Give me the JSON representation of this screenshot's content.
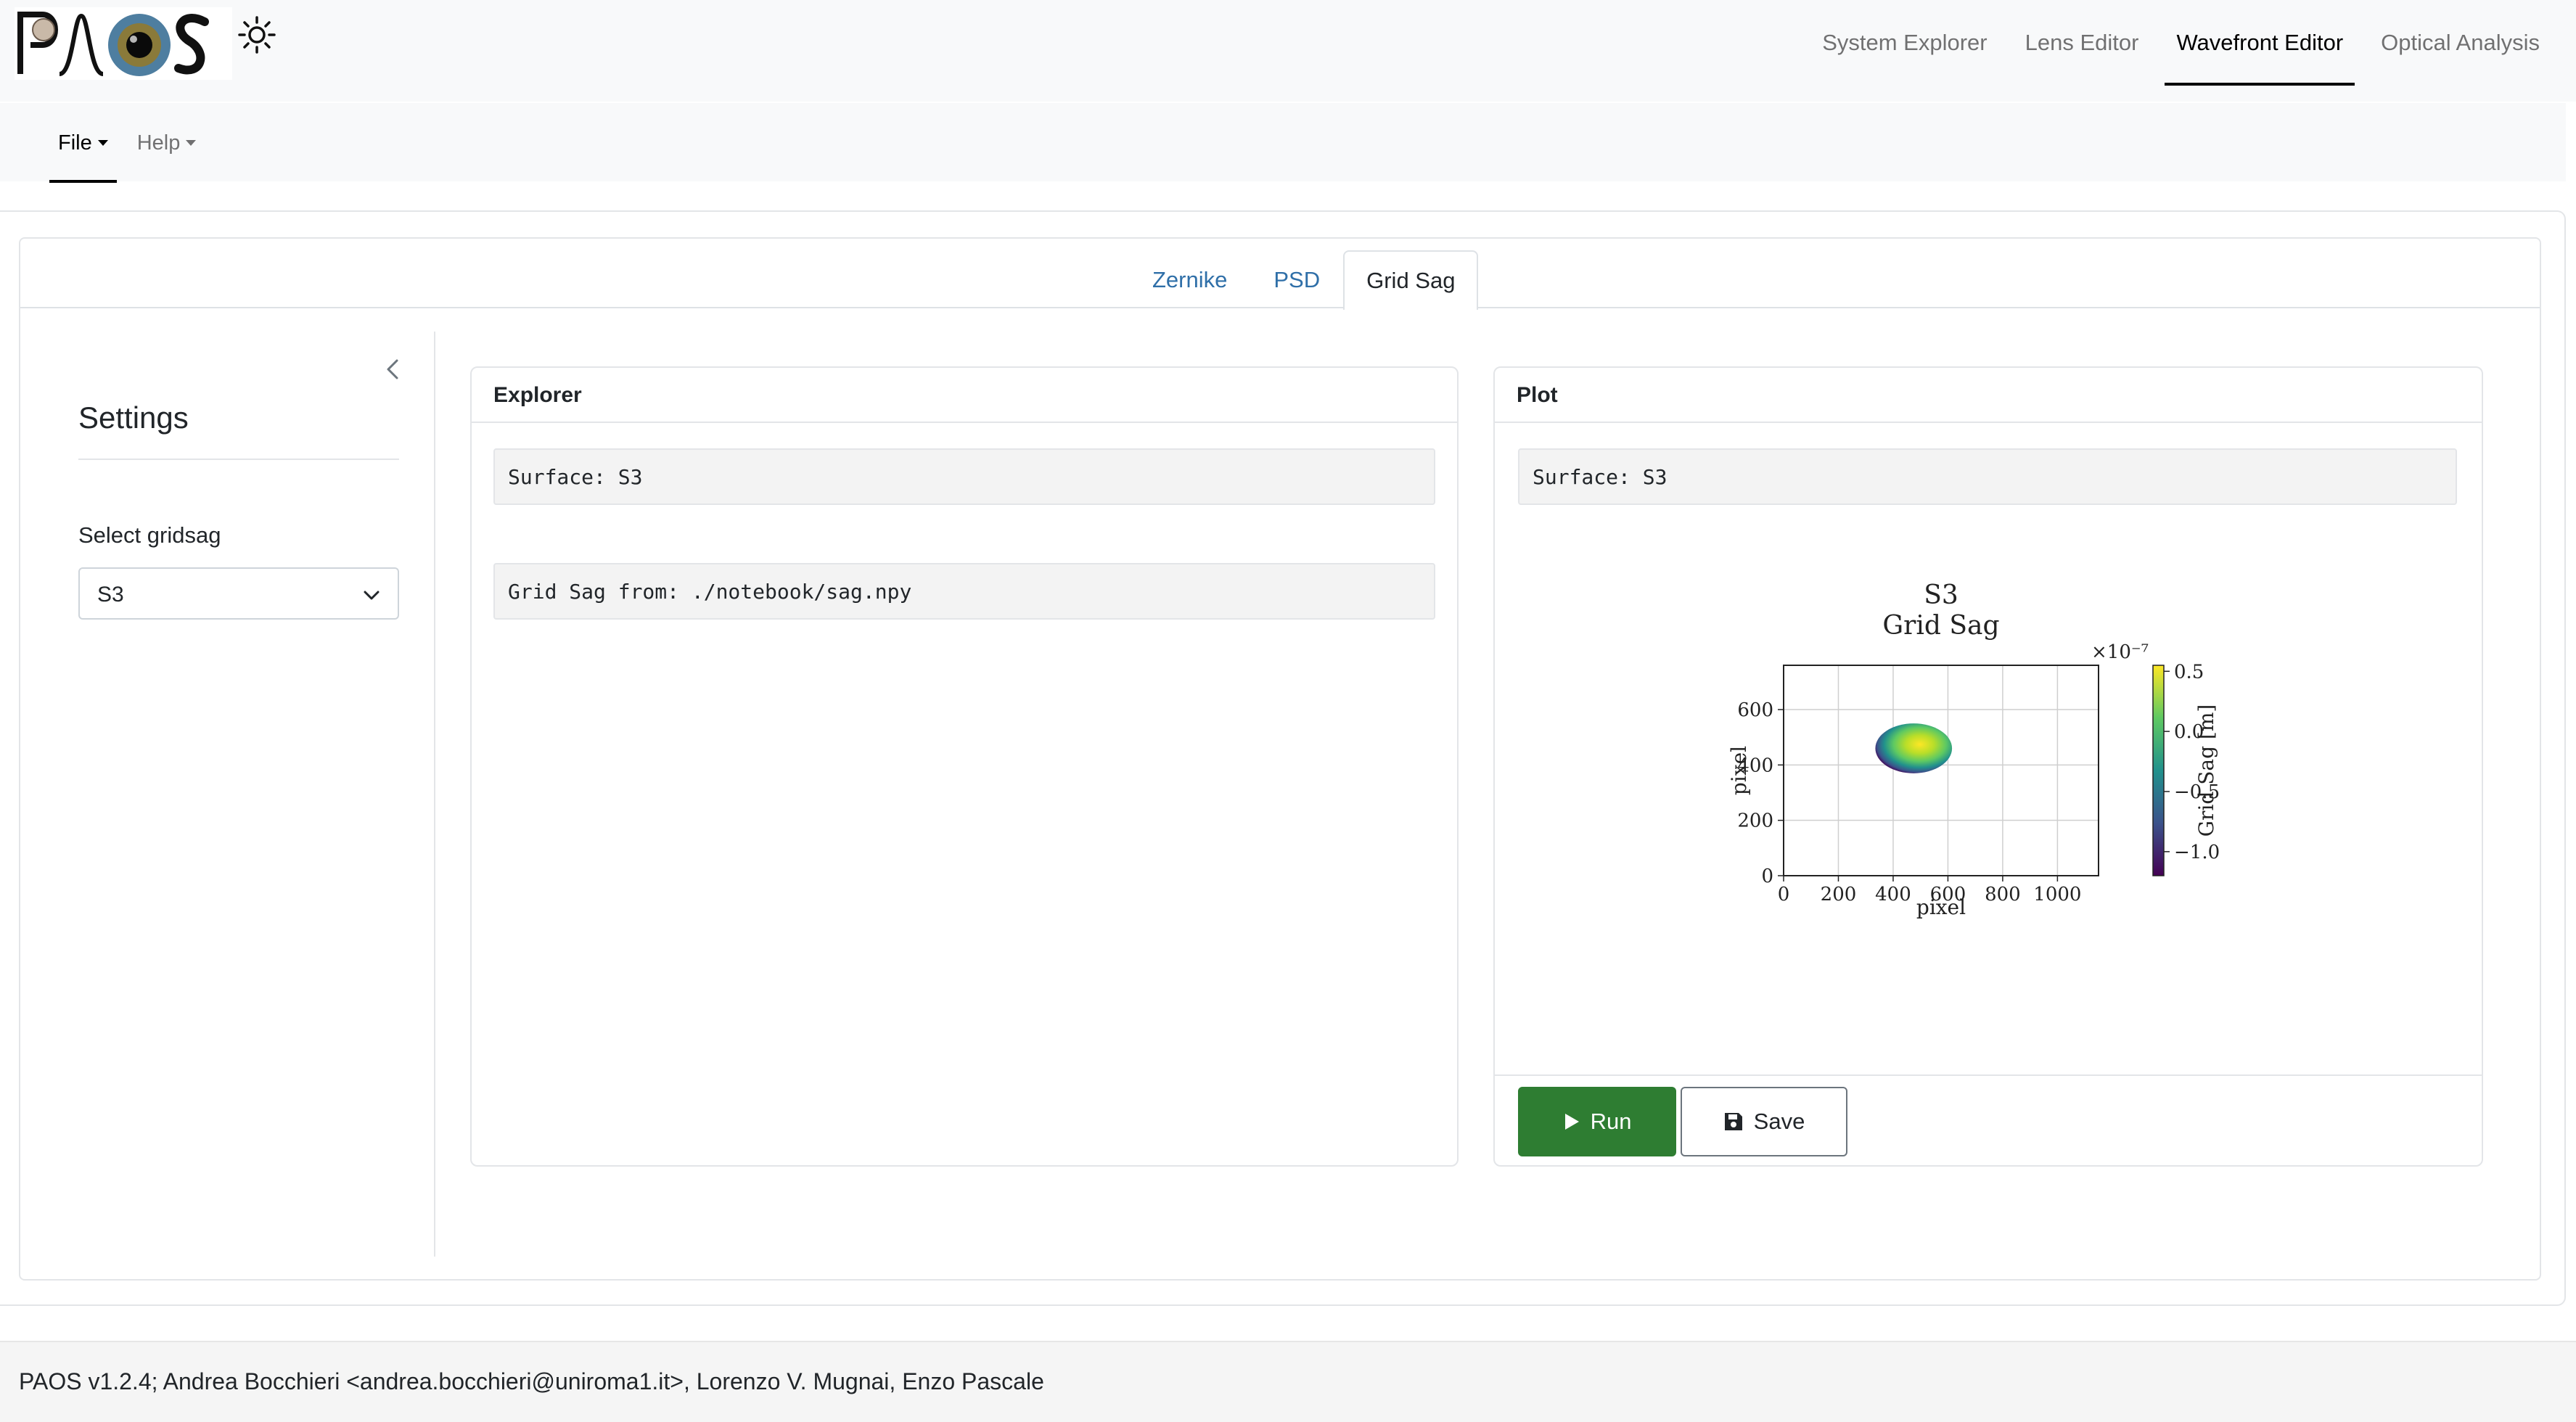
{
  "app": {
    "logo_text": "PAOS"
  },
  "top_nav": {
    "items": [
      "System Explorer",
      "Lens Editor",
      "Wavefront Editor",
      "Optical Analysis"
    ],
    "active": "Wavefront Editor"
  },
  "sub_nav": {
    "file_label": "File",
    "help_label": "Help"
  },
  "tabs": {
    "items": [
      "Zernike",
      "PSD",
      "Grid Sag"
    ],
    "active": "Grid Sag"
  },
  "settings": {
    "title": "Settings",
    "select_label": "Select gridsag",
    "select_value": "S3"
  },
  "explorer": {
    "title": "Explorer",
    "surface_line": "Surface: S3",
    "source_line": "Grid Sag from: ./notebook/sag.npy"
  },
  "plot": {
    "title": "Plot",
    "surface_line": "Surface: S3",
    "run_label": "Run",
    "save_label": "Save"
  },
  "chart_data": {
    "type": "heatmap",
    "title": "S3",
    "subtitle": "Grid Sag",
    "xlabel": "pixel",
    "ylabel": "pixel",
    "xlim": [
      0,
      1150
    ],
    "ylim": [
      0,
      760
    ],
    "x_ticks": [
      "0",
      "200",
      "400",
      "600",
      "800",
      "1000"
    ],
    "y_ticks": [
      "0",
      "200",
      "400",
      "600"
    ],
    "grid": true,
    "aperture": {
      "center": [
        475,
        460
      ],
      "semi_axes": [
        140,
        90
      ]
    },
    "colorbar": {
      "label": "Grid Sag [m]",
      "scale_label": "×10⁻⁷",
      "range": [
        -1.2,
        0.55
      ],
      "ticks": [
        "0.5",
        "0.0",
        "−0.5",
        "−1.0"
      ],
      "tick_values": [
        0.5,
        0.0,
        -0.5,
        -1.0
      ],
      "colormap": "viridis"
    }
  },
  "footer": {
    "text": "PAOS v1.2.4; Andrea Bocchieri <andrea.bocchieri@uniroma1.it>, Lorenzo V. Mugnai, Enzo Pascale"
  },
  "colors": {
    "accent_link": "#2f6fa8",
    "run_button": "#2e7d32",
    "navbar_bg": "#f8f9fa"
  }
}
